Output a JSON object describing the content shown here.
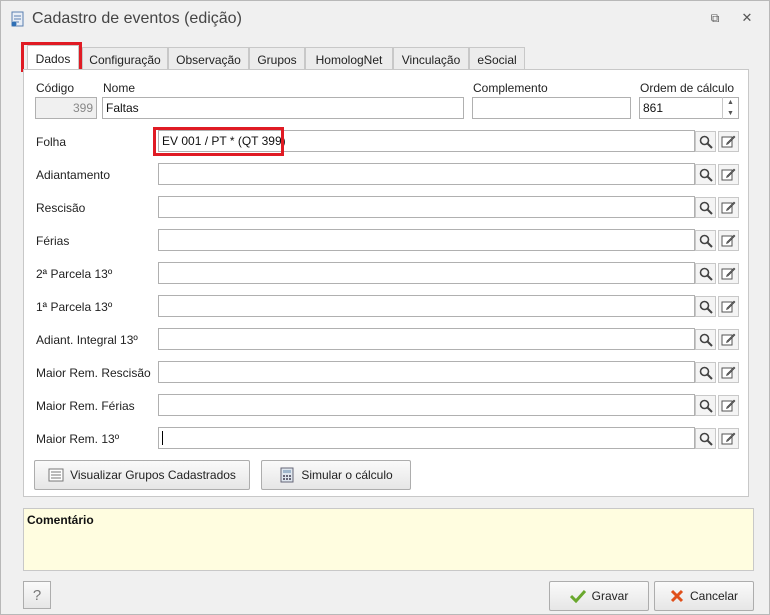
{
  "window": {
    "title": "Cadastro de eventos (edição)",
    "restore_glyph": "⧉",
    "close_glyph": "✕"
  },
  "tabs": [
    {
      "label": "Dados",
      "active": true
    },
    {
      "label": "Configuração"
    },
    {
      "label": "Observação"
    },
    {
      "label": "Grupos"
    },
    {
      "label": "HomologNet"
    },
    {
      "label": "Vinculação"
    },
    {
      "label": "eSocial"
    }
  ],
  "form": {
    "codigo_label": "Código",
    "codigo_value": "399",
    "nome_label": "Nome",
    "nome_value": "Faltas",
    "complemento_label": "Complemento",
    "complemento_value": "",
    "ordem_label": "Ordem de cálculo",
    "ordem_value": "861",
    "rows": [
      {
        "label": "Folha",
        "value": "EV 001 / PT * (QT 399)"
      },
      {
        "label": "Adiantamento",
        "value": ""
      },
      {
        "label": "Rescisão",
        "value": ""
      },
      {
        "label": "Férias",
        "value": ""
      },
      {
        "label": "2ª Parcela 13º",
        "value": ""
      },
      {
        "label": "1ª Parcela 13º",
        "value": ""
      },
      {
        "label": "Adiant. Integral 13º",
        "value": ""
      },
      {
        "label": "Maior Rem. Rescisão",
        "value": ""
      },
      {
        "label": "Maior Rem. Férias",
        "value": ""
      },
      {
        "label": "Maior Rem. 13º",
        "value": ""
      }
    ]
  },
  "buttons": {
    "visualizar": "Visualizar Grupos Cadastrados",
    "simular": "Simular o cálculo",
    "gravar": "Gravar",
    "cancelar": "Cancelar",
    "help": "?"
  },
  "comment": {
    "label": "Comentário",
    "value": ""
  },
  "colors": {
    "highlight": "#e01b24",
    "comment_bg": "#fffde0",
    "gravar_check": "#6aa82e",
    "cancelar_x": "#e0501b"
  }
}
